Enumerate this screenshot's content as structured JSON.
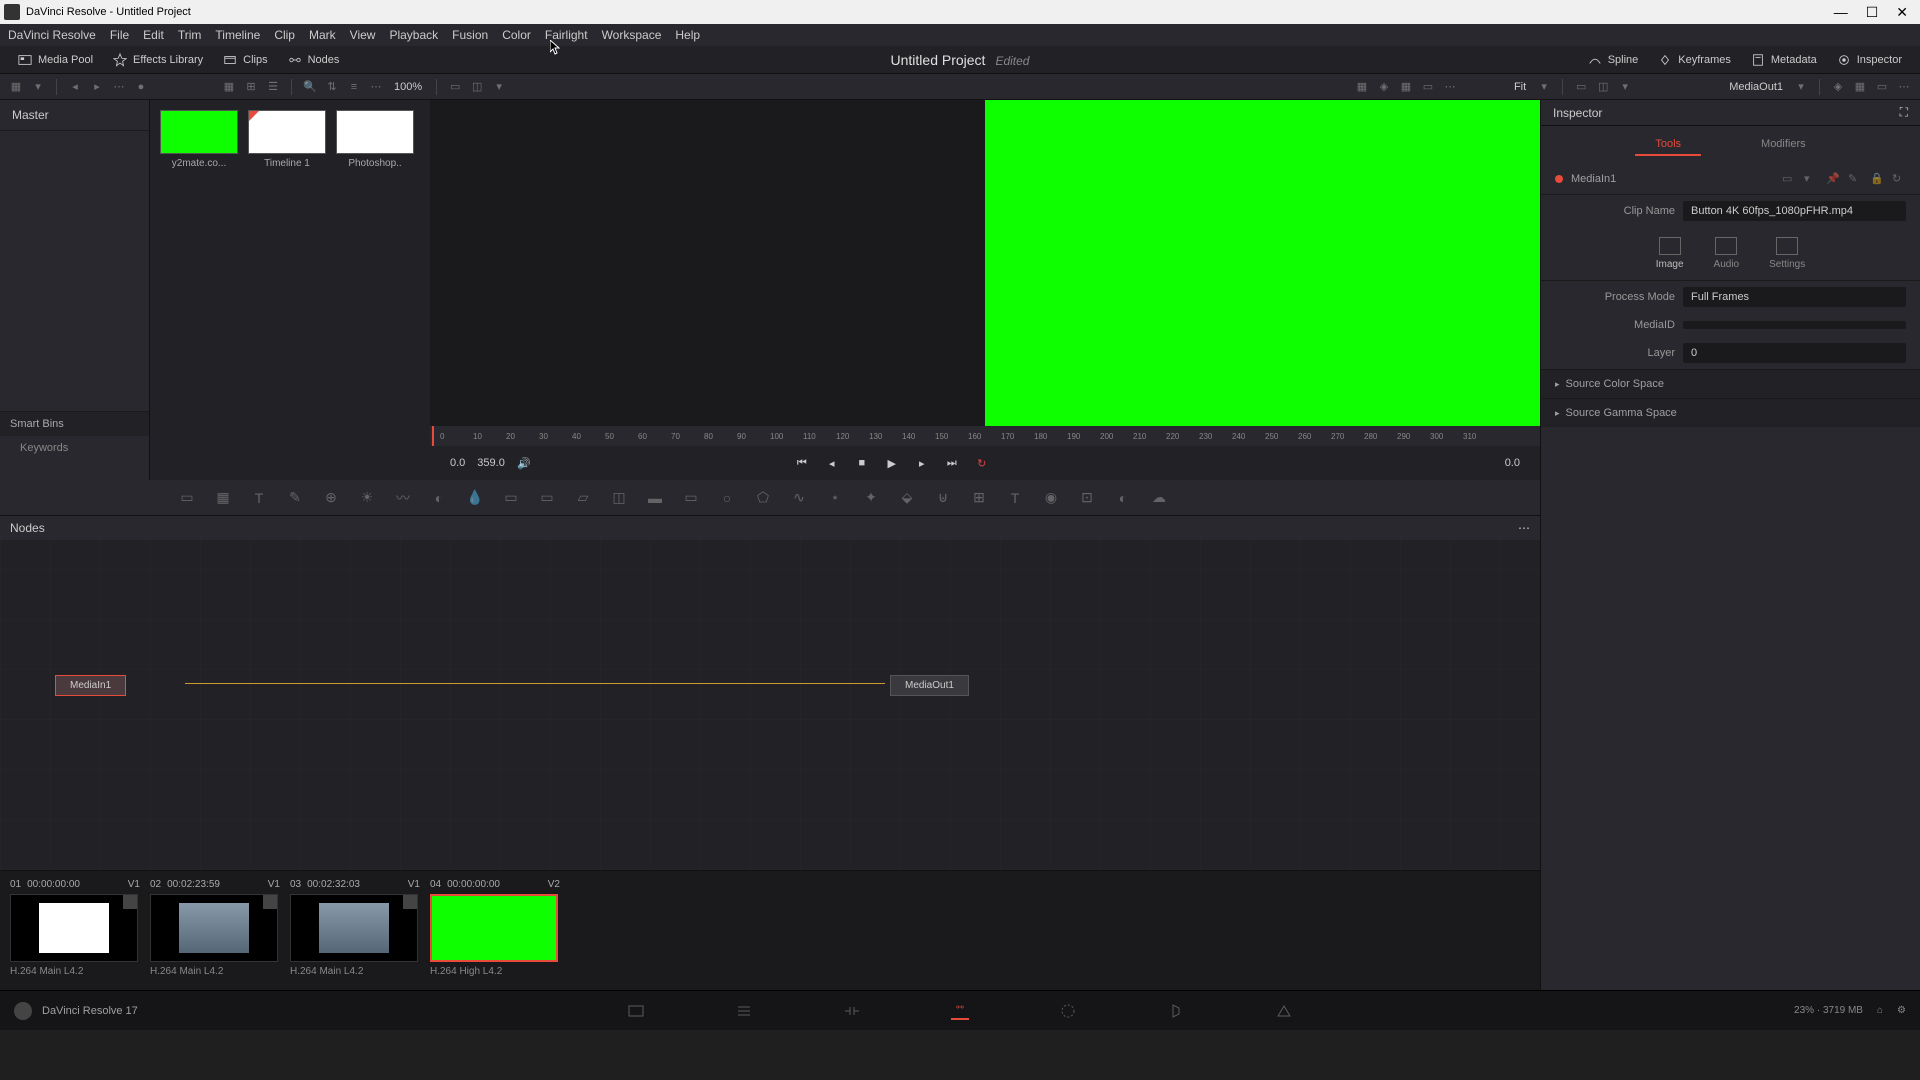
{
  "window_title": "DaVinci Resolve - Untitled Project",
  "menu": [
    "DaVinci Resolve",
    "File",
    "Edit",
    "Trim",
    "Timeline",
    "Clip",
    "Mark",
    "View",
    "Playback",
    "Fusion",
    "Color",
    "Fairlight",
    "Workspace",
    "Help"
  ],
  "topbar": {
    "media_pool": "Media Pool",
    "effects_library": "Effects Library",
    "clips": "Clips",
    "nodes": "Nodes",
    "spline": "Spline",
    "keyframes": "Keyframes",
    "metadata": "Metadata",
    "inspector": "Inspector"
  },
  "project": {
    "name": "Untitled Project",
    "status": "Edited"
  },
  "secbar": {
    "zoom": "100%",
    "fit": "Fit",
    "viewer_name": "MediaOut1"
  },
  "mediapool": {
    "master": "Master",
    "smartbins": "Smart Bins",
    "keywords": "Keywords"
  },
  "clips": [
    {
      "label": "y2mate.co...",
      "kind": "green"
    },
    {
      "label": "Timeline 1",
      "kind": "white"
    },
    {
      "label": "Photoshop..",
      "kind": "white"
    }
  ],
  "playbar": {
    "in": "0.0",
    "dur": "359.0",
    "out": "0.0"
  },
  "nodes": {
    "title": "Nodes",
    "n1": "MediaIn1",
    "n2": "MediaOut1"
  },
  "inspector": {
    "title": "Inspector",
    "tabs": {
      "tools": "Tools",
      "modifiers": "Modifiers"
    },
    "node_name": "MediaIn1",
    "clip_name_lbl": "Clip Name",
    "clip_name_val": "Button 4K 60fps_1080pFHR.mp4",
    "modes": {
      "image": "Image",
      "audio": "Audio",
      "settings": "Settings"
    },
    "process_mode_lbl": "Process Mode",
    "process_mode_val": "Full Frames",
    "mediaid_lbl": "MediaID",
    "layer_lbl": "Layer",
    "layer_val": "0",
    "src_color": "Source Color Space",
    "src_gamma": "Source Gamma Space"
  },
  "bottom_clips": [
    {
      "num": "01",
      "tc": "00:00:00:00",
      "trk": "V1",
      "codec": "H.264 Main L4.2",
      "kind": "white"
    },
    {
      "num": "02",
      "tc": "00:02:23:59",
      "trk": "V1",
      "codec": "H.264 Main L4.2",
      "kind": "img"
    },
    {
      "num": "03",
      "tc": "00:02:32:03",
      "trk": "V1",
      "codec": "H.264 Main L4.2",
      "kind": "img"
    },
    {
      "num": "04",
      "tc": "00:00:00:00",
      "trk": "V2",
      "codec": "H.264 High L4.2",
      "kind": "green",
      "active": true
    }
  ],
  "footer": {
    "app": "DaVinci Resolve 17",
    "stats": "23% · 3719 MB"
  }
}
